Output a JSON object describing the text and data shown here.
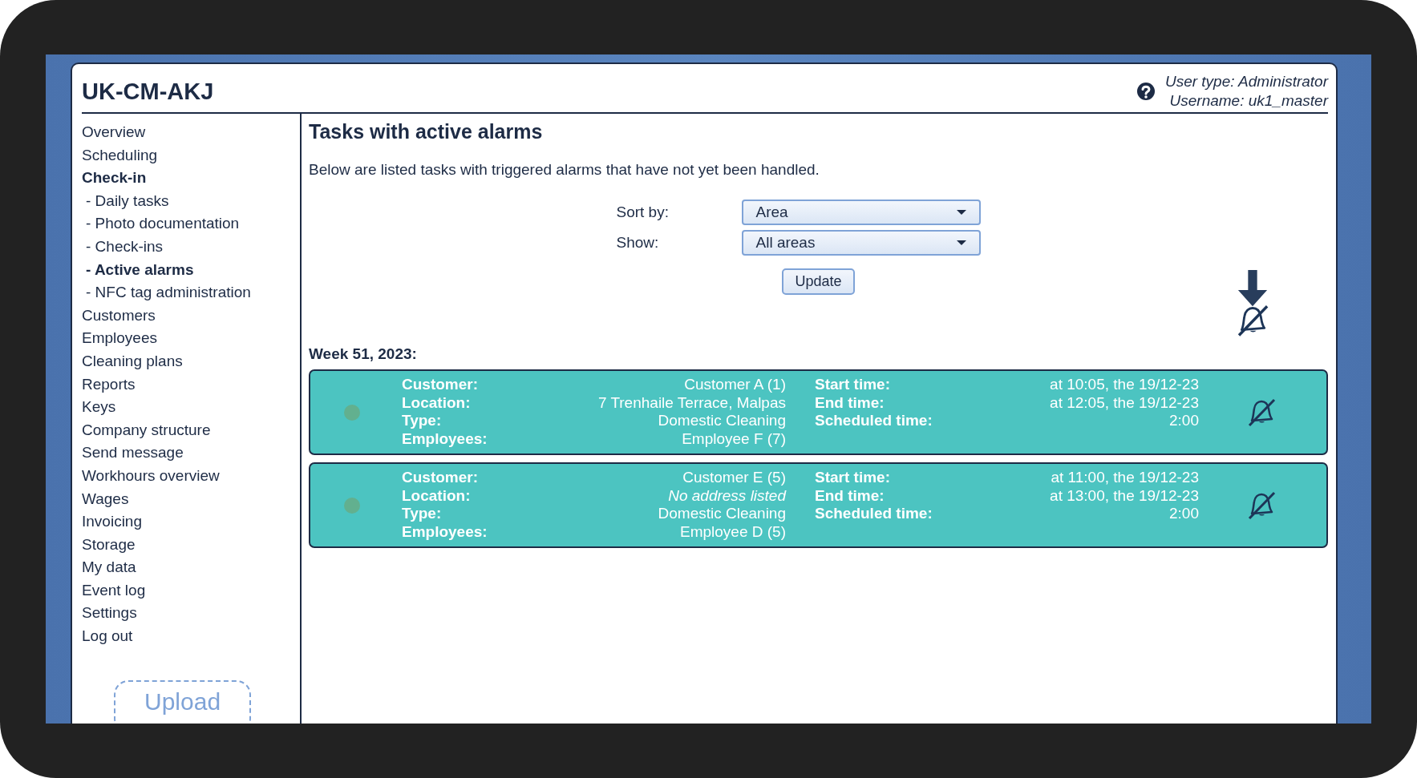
{
  "header": {
    "title": "UK-CM-AKJ",
    "user_type": "User type: Administrator",
    "username": "Username: uk1_master"
  },
  "sidebar": {
    "items": [
      {
        "label": "Overview",
        "selected": false
      },
      {
        "label": "Scheduling",
        "selected": false
      },
      {
        "label": "Check-in",
        "selected": true,
        "children": [
          {
            "label": "- Daily tasks",
            "selected": false
          },
          {
            "label": "- Photo documentation",
            "selected": false
          },
          {
            "label": "- Check-ins",
            "selected": false
          },
          {
            "label": "- Active alarms",
            "selected": true
          },
          {
            "label": "- NFC tag administration",
            "selected": false
          }
        ]
      },
      {
        "label": "Customers",
        "selected": false
      },
      {
        "label": "Employees",
        "selected": false
      },
      {
        "label": "Cleaning plans",
        "selected": false
      },
      {
        "label": "Reports",
        "selected": false
      },
      {
        "label": "Keys",
        "selected": false
      },
      {
        "label": "Company structure",
        "selected": false
      },
      {
        "label": "Send message",
        "selected": false
      },
      {
        "label": "Workhours overview",
        "selected": false
      },
      {
        "label": "Wages",
        "selected": false
      },
      {
        "label": "Invoicing",
        "selected": false
      },
      {
        "label": "Storage",
        "selected": false
      },
      {
        "label": "My data",
        "selected": false
      },
      {
        "label": "Event log",
        "selected": false
      },
      {
        "label": "Settings",
        "selected": false
      },
      {
        "label": "Log out",
        "selected": false
      }
    ],
    "upload_button": "Upload"
  },
  "main": {
    "title": "Tasks with active alarms",
    "description": "Below are listed tasks with triggered alarms that have not yet been handled.",
    "filters": [
      {
        "label": "Sort by:",
        "value": "Area"
      },
      {
        "label": "Show:",
        "value": "All areas"
      }
    ],
    "update_button": "Update",
    "week": "Week 51, 2023:",
    "tasks": [
      {
        "color": "#62b08f",
        "left": [
          {
            "label": "Customer:",
            "value": "Customer A (1)"
          },
          {
            "label": "Location:",
            "value": "7 Trenhaile Terrace, Malpas"
          },
          {
            "label": "Type:",
            "value": "Domestic Cleaning"
          },
          {
            "label": "Employees:",
            "value": "Employee F (7)"
          }
        ],
        "right": [
          {
            "label": "Start time:",
            "value": "at 10:05, the 19/12-23"
          },
          {
            "label": "End time:",
            "value": "at 12:05, the 19/12-23"
          },
          {
            "label": "Scheduled time:",
            "value": "2:00"
          }
        ]
      },
      {
        "color": "#62b08f",
        "left": [
          {
            "label": "Customer:",
            "value": "Customer E (5)"
          },
          {
            "label": "Location:",
            "value": "No address listed",
            "italic": true
          },
          {
            "label": "Type:",
            "value": "Domestic Cleaning"
          },
          {
            "label": "Employees:",
            "value": "Employee D (5)"
          }
        ],
        "right": [
          {
            "label": "Start time:",
            "value": "at 11:00, the 19/12-23"
          },
          {
            "label": "End time:",
            "value": "at 13:00, the 19/12-23"
          },
          {
            "label": "Scheduled time:",
            "value": "2:00"
          }
        ]
      }
    ]
  }
}
